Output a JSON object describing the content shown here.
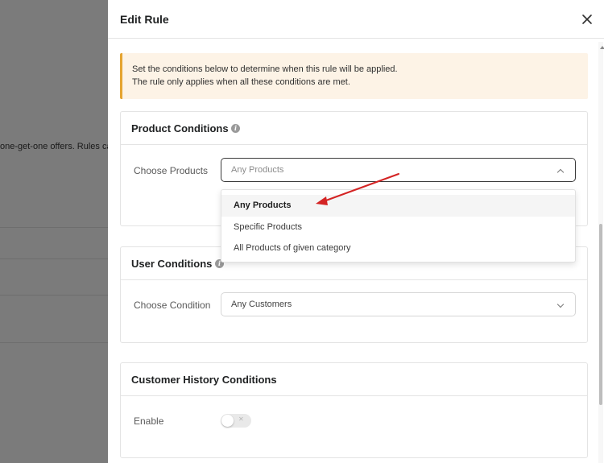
{
  "background": {
    "text": "one-get-one offers. Rules ca"
  },
  "drawer": {
    "title": "Edit Rule",
    "close_icon": "close-icon"
  },
  "notice": {
    "line1": "Set the conditions below to determine when this rule will be applied.",
    "line2": "The rule only applies when all these conditions are met."
  },
  "product_conditions": {
    "title": "Product Conditions",
    "field_label": "Choose Products",
    "placeholder": "Any Products",
    "dropdown_options": [
      "Any Products",
      "Specific Products",
      "All Products of given category"
    ],
    "selected_option": "Any Products"
  },
  "user_conditions": {
    "title": "User Conditions",
    "field_label": "Choose Condition",
    "value": "Any Customers"
  },
  "customer_history": {
    "title": "Customer History Conditions",
    "field_label": "Enable",
    "enabled": false
  },
  "colors": {
    "notice_bg": "#fdf3e6",
    "notice_accent": "#e5a431",
    "annotation_arrow": "#d42424",
    "overlay": "#7b7b7b"
  }
}
